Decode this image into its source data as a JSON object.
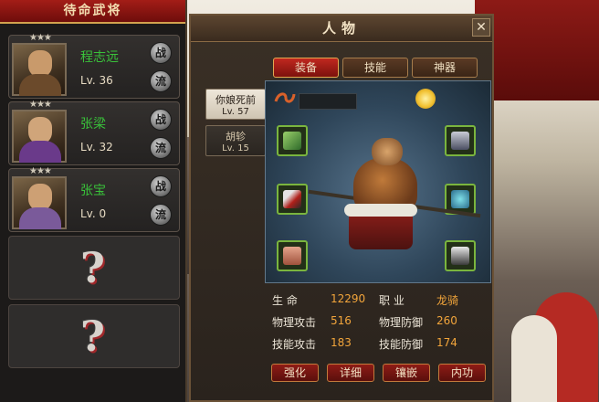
{
  "left_panel": {
    "title": "待命武将",
    "generals": [
      {
        "name": "程志远",
        "level": "Lv. 36",
        "skin": "#c89763",
        "garb": "#6b4a2b"
      },
      {
        "name": "张梁",
        "level": "Lv. 32",
        "skin": "#d0a57a",
        "garb": "#6a3a8a"
      },
      {
        "name": "张宝",
        "level": "Lv. 0",
        "skin": "#cda074",
        "garb": "#7a5a9a"
      }
    ],
    "battle_btn": "战",
    "flow_btn": "流",
    "empty_mark": "?"
  },
  "window": {
    "title": "人物",
    "close": "✕",
    "tabs": [
      "装备",
      "技能",
      "神器"
    ],
    "active_tab": "装备",
    "generals": [
      {
        "name": "你娘死前",
        "level": "Lv. 57"
      },
      {
        "name": "胡轸",
        "level": "Lv. 15"
      }
    ],
    "stats": {
      "hp_label": "生    命",
      "hp": "12290",
      "class_label": "职    业",
      "class": "龙骑",
      "patk_label": "物理攻击",
      "patk": "516",
      "pdef_label": "物理防御",
      "pdef": "260",
      "satk_label": "技能攻击",
      "satk": "183",
      "sdef_label": "技能防御",
      "sdef": "174"
    },
    "actions": [
      "强化",
      "详细",
      "镶嵌",
      "内功"
    ]
  },
  "icons": {
    "title_scroll": "dragon-scroll-icon",
    "sun": "sun-medal-icon"
  }
}
